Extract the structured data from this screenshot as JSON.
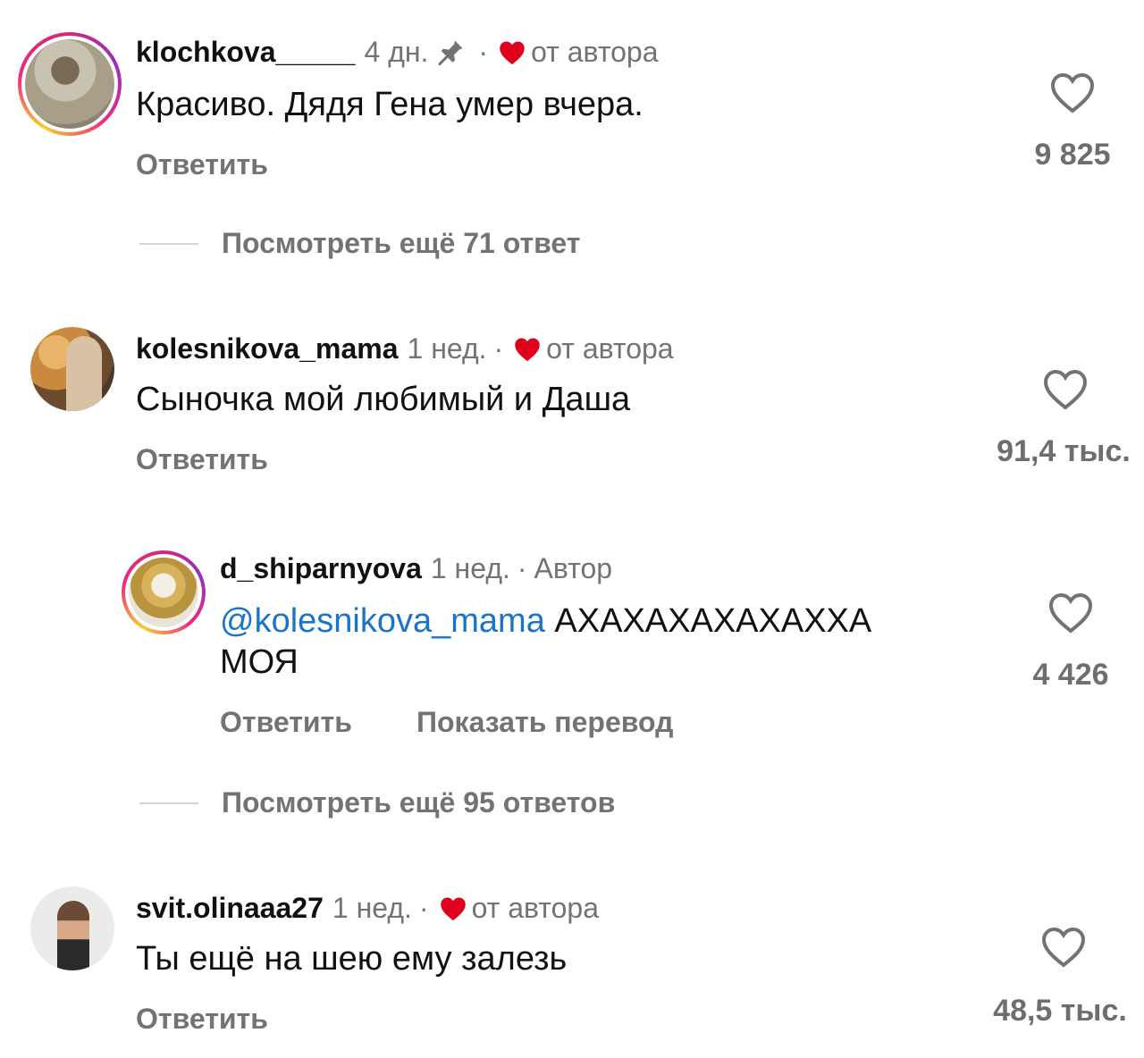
{
  "colors": {
    "text": "#111111",
    "muted": "#737373",
    "like_heart": "#e0001b",
    "mention": "#1a74c7",
    "divider": "#d4d4d4"
  },
  "comments": [
    {
      "username": "klochkova_____",
      "time": "4 дн.",
      "pinned": true,
      "dot": "·",
      "liked_by_author": "от автора",
      "text": "Красиво. Дядя Гена умер вчера.",
      "reply": "Ответить",
      "likes": "9 825",
      "view_replies": "Посмотреть ещё 71 ответ"
    },
    {
      "username": "kolesnikova_mama",
      "time": "1 нед.",
      "dot": "·",
      "liked_by_author": "от автора",
      "text": "Сыночка мой любимый и Даша",
      "reply": "Ответить",
      "likes": "91,4 тыс.",
      "replies": [
        {
          "username": "d_shiparnyova",
          "time": "1 нед.",
          "dot": "·",
          "author_badge": "Автор",
          "mention": "@kolesnikova_mama",
          "text_line1": "АХАХАХАХАХАХХА",
          "text_line2": "МОЯ",
          "reply": "Ответить",
          "translate": "Показать перевод",
          "likes": "4 426"
        }
      ],
      "view_replies": "Посмотреть ещё 95 ответов"
    },
    {
      "username": "svit.olinaaa27",
      "time": "1 нед.",
      "dot": "·",
      "liked_by_author": "от автора",
      "text": "Ты ещё на шею ему залезь",
      "reply": "Ответить",
      "likes": "48,5 тыс."
    }
  ]
}
